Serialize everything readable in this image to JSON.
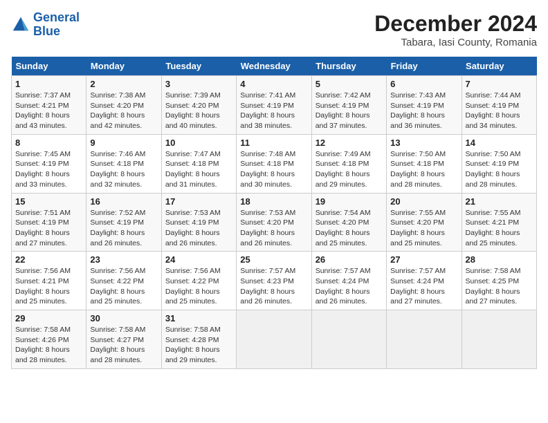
{
  "logo": {
    "line1": "General",
    "line2": "Blue"
  },
  "title": "December 2024",
  "location": "Tabara, Iasi County, Romania",
  "days_of_week": [
    "Sunday",
    "Monday",
    "Tuesday",
    "Wednesday",
    "Thursday",
    "Friday",
    "Saturday"
  ],
  "weeks": [
    [
      {
        "day": "1",
        "detail": "Sunrise: 7:37 AM\nSunset: 4:21 PM\nDaylight: 8 hours\nand 43 minutes."
      },
      {
        "day": "2",
        "detail": "Sunrise: 7:38 AM\nSunset: 4:20 PM\nDaylight: 8 hours\nand 42 minutes."
      },
      {
        "day": "3",
        "detail": "Sunrise: 7:39 AM\nSunset: 4:20 PM\nDaylight: 8 hours\nand 40 minutes."
      },
      {
        "day": "4",
        "detail": "Sunrise: 7:41 AM\nSunset: 4:19 PM\nDaylight: 8 hours\nand 38 minutes."
      },
      {
        "day": "5",
        "detail": "Sunrise: 7:42 AM\nSunset: 4:19 PM\nDaylight: 8 hours\nand 37 minutes."
      },
      {
        "day": "6",
        "detail": "Sunrise: 7:43 AM\nSunset: 4:19 PM\nDaylight: 8 hours\nand 36 minutes."
      },
      {
        "day": "7",
        "detail": "Sunrise: 7:44 AM\nSunset: 4:19 PM\nDaylight: 8 hours\nand 34 minutes."
      }
    ],
    [
      {
        "day": "8",
        "detail": "Sunrise: 7:45 AM\nSunset: 4:19 PM\nDaylight: 8 hours\nand 33 minutes."
      },
      {
        "day": "9",
        "detail": "Sunrise: 7:46 AM\nSunset: 4:18 PM\nDaylight: 8 hours\nand 32 minutes."
      },
      {
        "day": "10",
        "detail": "Sunrise: 7:47 AM\nSunset: 4:18 PM\nDaylight: 8 hours\nand 31 minutes."
      },
      {
        "day": "11",
        "detail": "Sunrise: 7:48 AM\nSunset: 4:18 PM\nDaylight: 8 hours\nand 30 minutes."
      },
      {
        "day": "12",
        "detail": "Sunrise: 7:49 AM\nSunset: 4:18 PM\nDaylight: 8 hours\nand 29 minutes."
      },
      {
        "day": "13",
        "detail": "Sunrise: 7:50 AM\nSunset: 4:18 PM\nDaylight: 8 hours\nand 28 minutes."
      },
      {
        "day": "14",
        "detail": "Sunrise: 7:50 AM\nSunset: 4:19 PM\nDaylight: 8 hours\nand 28 minutes."
      }
    ],
    [
      {
        "day": "15",
        "detail": "Sunrise: 7:51 AM\nSunset: 4:19 PM\nDaylight: 8 hours\nand 27 minutes."
      },
      {
        "day": "16",
        "detail": "Sunrise: 7:52 AM\nSunset: 4:19 PM\nDaylight: 8 hours\nand 26 minutes."
      },
      {
        "day": "17",
        "detail": "Sunrise: 7:53 AM\nSunset: 4:19 PM\nDaylight: 8 hours\nand 26 minutes."
      },
      {
        "day": "18",
        "detail": "Sunrise: 7:53 AM\nSunset: 4:20 PM\nDaylight: 8 hours\nand 26 minutes."
      },
      {
        "day": "19",
        "detail": "Sunrise: 7:54 AM\nSunset: 4:20 PM\nDaylight: 8 hours\nand 25 minutes."
      },
      {
        "day": "20",
        "detail": "Sunrise: 7:55 AM\nSunset: 4:20 PM\nDaylight: 8 hours\nand 25 minutes."
      },
      {
        "day": "21",
        "detail": "Sunrise: 7:55 AM\nSunset: 4:21 PM\nDaylight: 8 hours\nand 25 minutes."
      }
    ],
    [
      {
        "day": "22",
        "detail": "Sunrise: 7:56 AM\nSunset: 4:21 PM\nDaylight: 8 hours\nand 25 minutes."
      },
      {
        "day": "23",
        "detail": "Sunrise: 7:56 AM\nSunset: 4:22 PM\nDaylight: 8 hours\nand 25 minutes."
      },
      {
        "day": "24",
        "detail": "Sunrise: 7:56 AM\nSunset: 4:22 PM\nDaylight: 8 hours\nand 25 minutes."
      },
      {
        "day": "25",
        "detail": "Sunrise: 7:57 AM\nSunset: 4:23 PM\nDaylight: 8 hours\nand 26 minutes."
      },
      {
        "day": "26",
        "detail": "Sunrise: 7:57 AM\nSunset: 4:24 PM\nDaylight: 8 hours\nand 26 minutes."
      },
      {
        "day": "27",
        "detail": "Sunrise: 7:57 AM\nSunset: 4:24 PM\nDaylight: 8 hours\nand 27 minutes."
      },
      {
        "day": "28",
        "detail": "Sunrise: 7:58 AM\nSunset: 4:25 PM\nDaylight: 8 hours\nand 27 minutes."
      }
    ],
    [
      {
        "day": "29",
        "detail": "Sunrise: 7:58 AM\nSunset: 4:26 PM\nDaylight: 8 hours\nand 28 minutes."
      },
      {
        "day": "30",
        "detail": "Sunrise: 7:58 AM\nSunset: 4:27 PM\nDaylight: 8 hours\nand 28 minutes."
      },
      {
        "day": "31",
        "detail": "Sunrise: 7:58 AM\nSunset: 4:28 PM\nDaylight: 8 hours\nand 29 minutes."
      },
      {
        "day": "",
        "detail": ""
      },
      {
        "day": "",
        "detail": ""
      },
      {
        "day": "",
        "detail": ""
      },
      {
        "day": "",
        "detail": ""
      }
    ]
  ]
}
